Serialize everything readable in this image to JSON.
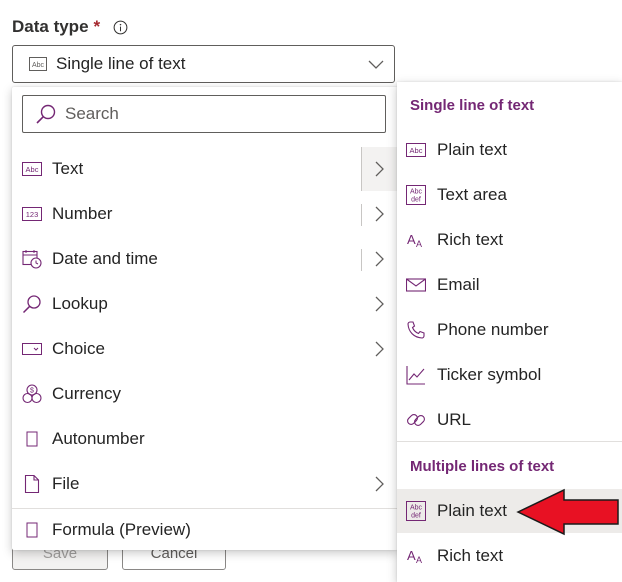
{
  "field": {
    "label": "Data type",
    "required_mark": "*",
    "selected_icon": "abc-icon",
    "selected_value": "Single line of text"
  },
  "background_buttons": {
    "save": "Save",
    "cancel": "Cancel"
  },
  "menu": {
    "search_placeholder": "Search",
    "items": [
      {
        "label": "Text",
        "icon": "abc-icon",
        "submenu": true,
        "active": true
      },
      {
        "label": "Number",
        "icon": "number-icon",
        "submenu": true
      },
      {
        "label": "Date and time",
        "icon": "calendar-clock-icon",
        "submenu": true
      },
      {
        "label": "Lookup",
        "icon": "search-icon",
        "submenu": true
      },
      {
        "label": "Choice",
        "icon": "choice-icon",
        "submenu": true
      },
      {
        "label": "Currency",
        "icon": "currency-icon",
        "submenu": false
      },
      {
        "label": "Autonumber",
        "icon": "autonumber-icon",
        "submenu": false
      },
      {
        "label": "File",
        "icon": "file-icon",
        "submenu": true
      },
      {
        "label": "Formula (Preview)",
        "icon": "formula-icon",
        "submenu": false
      }
    ]
  },
  "submenu": {
    "single_header": "Single line of text",
    "single_items": [
      {
        "label": "Plain text",
        "icon": "abc-icon"
      },
      {
        "label": "Text area",
        "icon": "text-area-icon"
      },
      {
        "label": "Rich text",
        "icon": "rich-text-icon"
      },
      {
        "label": "Email",
        "icon": "mail-icon"
      },
      {
        "label": "Phone number",
        "icon": "phone-icon"
      },
      {
        "label": "Ticker symbol",
        "icon": "chart-icon"
      },
      {
        "label": "URL",
        "icon": "link-icon"
      }
    ],
    "multi_header": "Multiple lines of text",
    "multi_items": [
      {
        "label": "Plain text",
        "icon": "text-area-icon",
        "selected": true
      },
      {
        "label": "Rich text",
        "icon": "rich-text-icon"
      }
    ]
  },
  "colors": {
    "accent": "#742774",
    "annotation_arrow": "#e81123",
    "icon": "#742774"
  }
}
